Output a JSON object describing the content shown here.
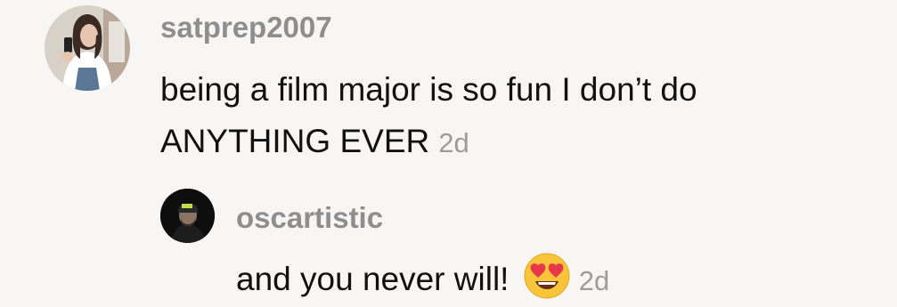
{
  "comments": [
    {
      "username": "satprep2007",
      "text_line1": "being a film major is so fun I don’t do",
      "text_line2": "ANYTHING EVER",
      "age": "2d"
    },
    {
      "username": "oscartistic",
      "text": "and you never will!",
      "emoji": "heart-eyes-emoji",
      "age": "2d"
    }
  ],
  "colors": {
    "background": "#f7f6f5",
    "username": "#8e8e8e",
    "text": "#111111",
    "age": "#9c9c9c"
  }
}
